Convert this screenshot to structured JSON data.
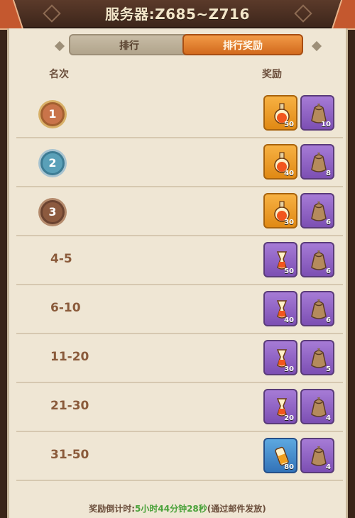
{
  "header": {
    "title": "服务器:Z685~Z716"
  },
  "tabs": [
    {
      "label": "排行",
      "active": false
    },
    {
      "label": "排行奖励",
      "active": true
    }
  ],
  "columns": {
    "rank": "名次",
    "reward": "奖励"
  },
  "rows": [
    {
      "rank": "1",
      "medal": "gold",
      "items": [
        {
          "kind": "potion-flask",
          "color": "orange",
          "qty": "50"
        },
        {
          "kind": "sack",
          "color": "purple",
          "qty": "10"
        }
      ]
    },
    {
      "rank": "2",
      "medal": "silver",
      "items": [
        {
          "kind": "potion-flask",
          "color": "orange",
          "qty": "40"
        },
        {
          "kind": "sack",
          "color": "purple",
          "qty": "8"
        }
      ]
    },
    {
      "rank": "3",
      "medal": "bronze",
      "items": [
        {
          "kind": "potion-flask",
          "color": "orange",
          "qty": "30"
        },
        {
          "kind": "sack",
          "color": "purple",
          "qty": "6"
        }
      ]
    },
    {
      "rank": "4-5",
      "items": [
        {
          "kind": "potion-bottle",
          "color": "purple",
          "qty": "50"
        },
        {
          "kind": "sack",
          "color": "purple",
          "qty": "6"
        }
      ]
    },
    {
      "rank": "6-10",
      "items": [
        {
          "kind": "potion-bottle",
          "color": "purple",
          "qty": "40"
        },
        {
          "kind": "sack",
          "color": "purple",
          "qty": "6"
        }
      ]
    },
    {
      "rank": "11-20",
      "items": [
        {
          "kind": "potion-bottle",
          "color": "purple",
          "qty": "30"
        },
        {
          "kind": "sack",
          "color": "purple",
          "qty": "5"
        }
      ]
    },
    {
      "rank": "21-30",
      "items": [
        {
          "kind": "potion-bottle",
          "color": "purple",
          "qty": "20"
        },
        {
          "kind": "sack",
          "color": "purple",
          "qty": "4"
        }
      ]
    },
    {
      "rank": "31-50",
      "items": [
        {
          "kind": "potion-vial",
          "color": "blue",
          "qty": "80"
        },
        {
          "kind": "sack",
          "color": "purple",
          "qty": "4"
        }
      ]
    }
  ],
  "footer": {
    "prefix": "奖励倒计时:",
    "time": "5小时44分钟28秒",
    "suffix": "(通过邮件发放)"
  }
}
